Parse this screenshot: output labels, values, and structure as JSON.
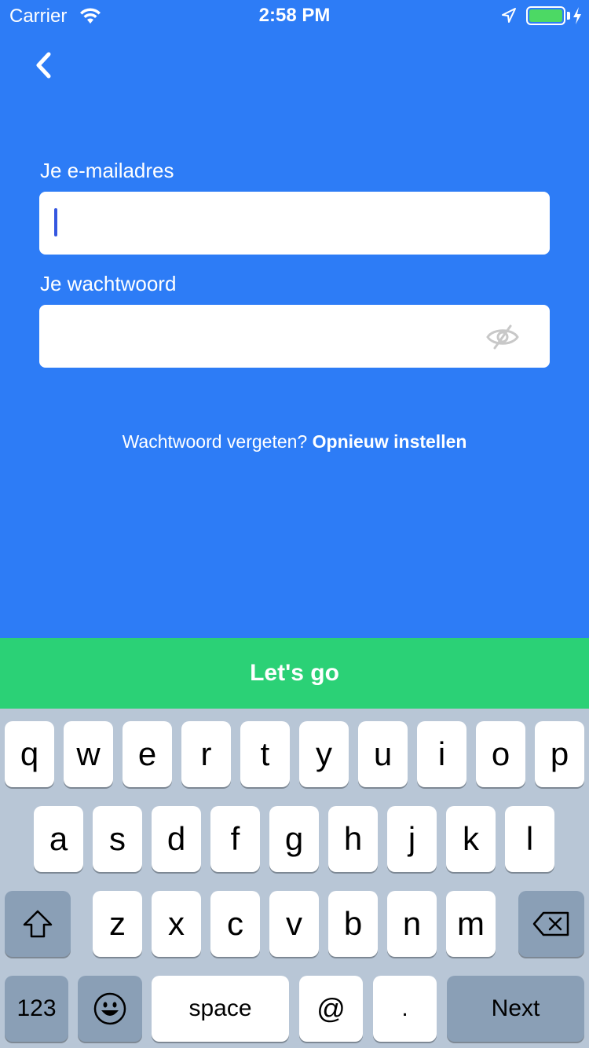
{
  "status": {
    "carrier": "Carrier",
    "time": "2:58 PM"
  },
  "form": {
    "email_label": "Je e-mailadres",
    "email_value": "",
    "password_label": "Je wachtwoord",
    "password_value": ""
  },
  "forgot": {
    "text": "Wachtwoord vergeten?",
    "link": "Opnieuw instellen"
  },
  "submit_label": "Let's go",
  "keyboard": {
    "row1": [
      "q",
      "w",
      "e",
      "r",
      "t",
      "y",
      "u",
      "i",
      "o",
      "p"
    ],
    "row2": [
      "a",
      "s",
      "d",
      "f",
      "g",
      "h",
      "j",
      "k",
      "l"
    ],
    "row3": [
      "z",
      "x",
      "c",
      "v",
      "b",
      "n",
      "m"
    ],
    "numbers_key": "123",
    "space_key": "space",
    "at_key": "@",
    "dot_key": ".",
    "next_key": "Next"
  },
  "colors": {
    "background": "#2d7cf6",
    "button": "#2bd176",
    "keyboard": "#b8c6d6"
  }
}
